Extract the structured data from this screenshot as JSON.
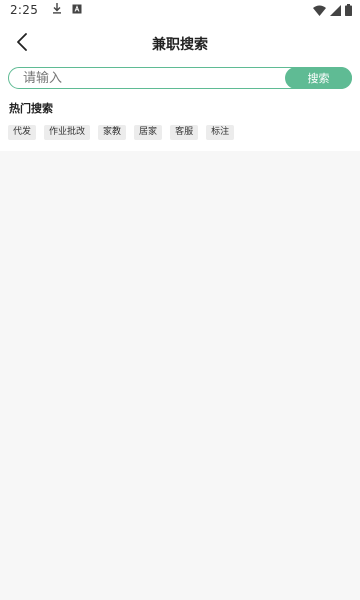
{
  "status_bar": {
    "time": "2:25",
    "icons": [
      "download-icon",
      "app-notification-icon",
      "wifi-icon",
      "signal-icon",
      "battery-icon"
    ]
  },
  "header": {
    "title": "兼职搜索",
    "back_icon": "chevron-left-icon"
  },
  "search": {
    "placeholder": "请输入",
    "value": "",
    "button_label": "搜索",
    "accent_color": "#5fbb94"
  },
  "hot_search": {
    "title": "热门搜索",
    "tags": [
      "代发",
      "作业批改",
      "家教",
      "居家",
      "客服",
      "标注"
    ]
  }
}
